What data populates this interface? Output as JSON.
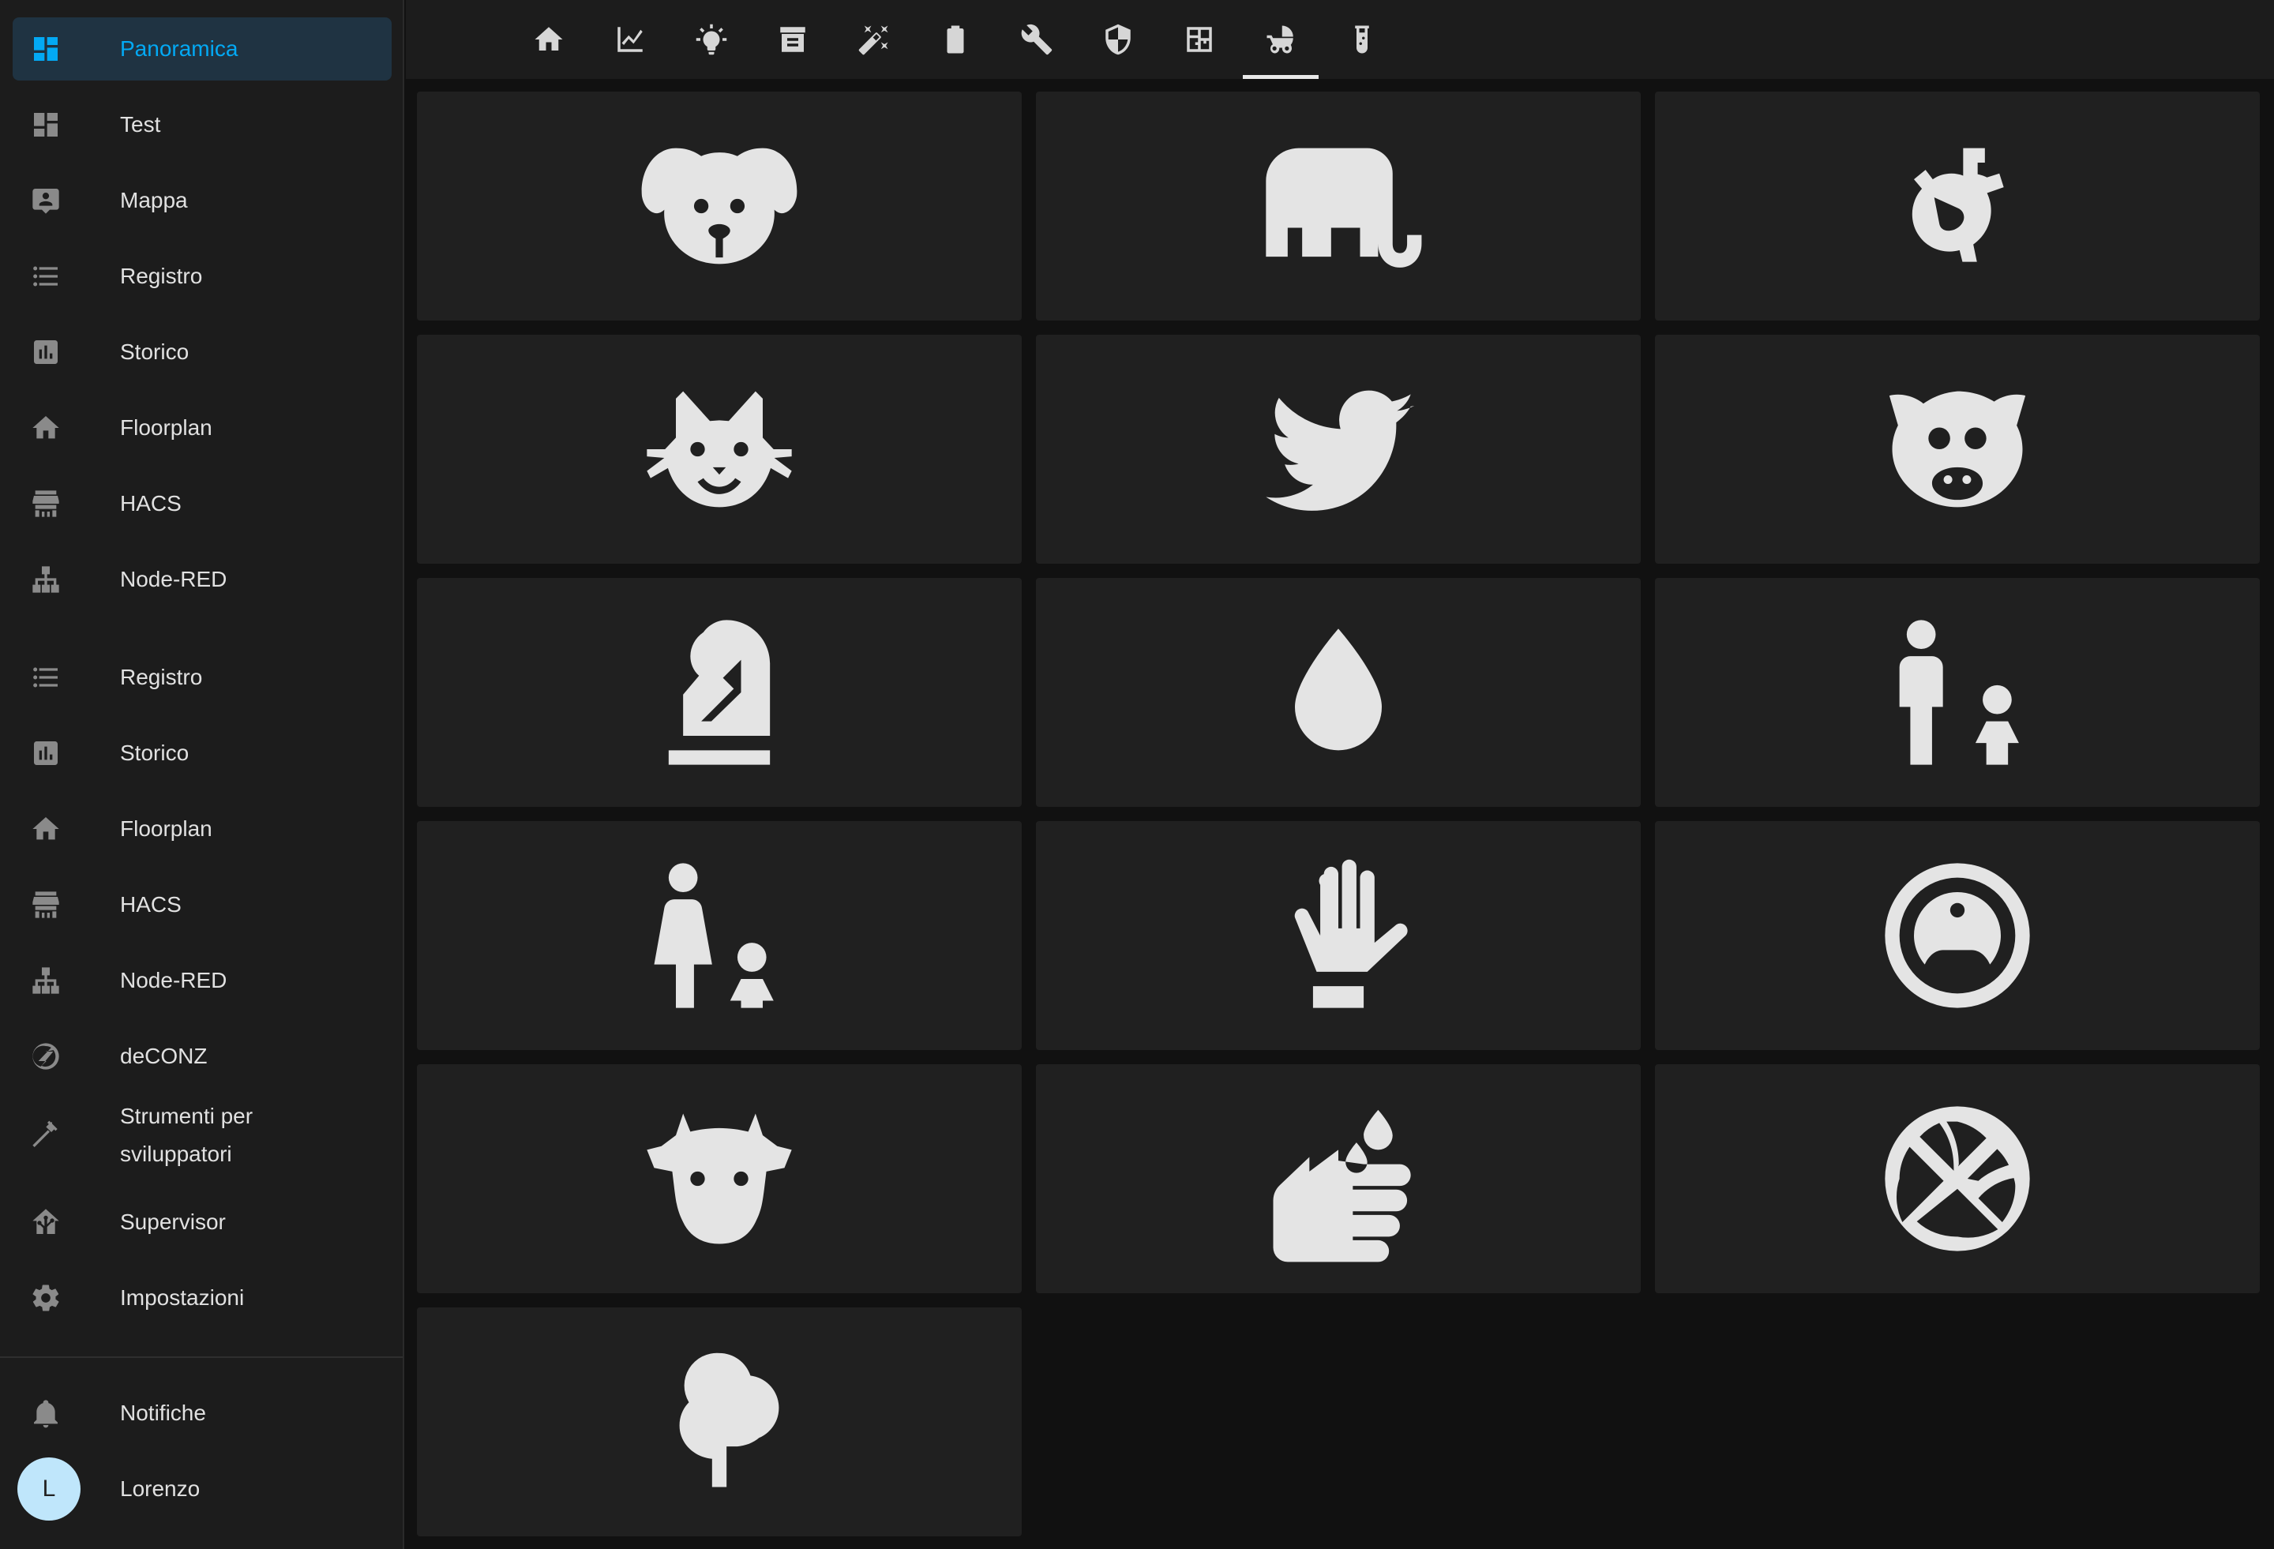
{
  "sidebar": {
    "items": [
      {
        "label": "Panoramica",
        "icon": "dashboard-icon",
        "active": true
      },
      {
        "label": "Test",
        "icon": "dashboard-icon"
      },
      {
        "label": "Mappa",
        "icon": "map-account-icon"
      },
      {
        "label": "Registro",
        "icon": "list-icon"
      },
      {
        "label": "Storico",
        "icon": "chart-box-icon"
      },
      {
        "label": "Floorplan",
        "icon": "home-icon"
      },
      {
        "label": "HACS",
        "icon": "hacs-icon"
      },
      {
        "label": "Node-RED",
        "icon": "sitemap-icon"
      },
      {
        "label": "Registro",
        "icon": "list-icon"
      },
      {
        "label": "Storico",
        "icon": "chart-box-icon"
      },
      {
        "label": "Floorplan",
        "icon": "home-icon"
      },
      {
        "label": "HACS",
        "icon": "hacs-icon"
      },
      {
        "label": "Node-RED",
        "icon": "sitemap-icon"
      },
      {
        "label": "deCONZ",
        "icon": "zigbee-icon"
      },
      {
        "label": "Strumenti per sviluppatori",
        "icon": "hammer-icon"
      },
      {
        "label": "Supervisor",
        "icon": "home-assistant-icon"
      },
      {
        "label": "Impostazioni",
        "icon": "gear-icon"
      }
    ],
    "notifications_label": "Notifiche",
    "user": {
      "name": "Lorenzo",
      "initial": "L"
    }
  },
  "header": {
    "tabs": [
      {
        "icon": "home-icon"
      },
      {
        "icon": "chart-line-icon"
      },
      {
        "icon": "lightbulb-icon"
      },
      {
        "icon": "storage-icon"
      },
      {
        "icon": "magic-wand-icon"
      },
      {
        "icon": "battery-icon"
      },
      {
        "icon": "wrench-icon"
      },
      {
        "icon": "shield-icon"
      },
      {
        "icon": "floorplan-icon"
      },
      {
        "icon": "baby-carriage-icon",
        "active": true
      },
      {
        "icon": "test-tube-icon"
      }
    ]
  },
  "cards": [
    {
      "icon": "dog-icon"
    },
    {
      "icon": "elephant-icon"
    },
    {
      "icon": "bee-icon"
    },
    {
      "icon": "cat-icon"
    },
    {
      "icon": "twitter-bird-icon"
    },
    {
      "icon": "pig-icon"
    },
    {
      "icon": "chess-knight-icon"
    },
    {
      "icon": "water-drop-icon"
    },
    {
      "icon": "human-male-child-icon"
    },
    {
      "icon": "human-female-child-icon"
    },
    {
      "icon": "hand-icon"
    },
    {
      "icon": "robot-vacuum-icon"
    },
    {
      "icon": "cow-icon"
    },
    {
      "icon": "hand-wash-icon"
    },
    {
      "icon": "basketball-icon"
    },
    {
      "icon": "tree-icon"
    }
  ],
  "colors": {
    "accent": "#03a9f4",
    "sidebar_bg": "#1c1c1c",
    "card_bg": "#202020",
    "page_bg": "#111111"
  }
}
